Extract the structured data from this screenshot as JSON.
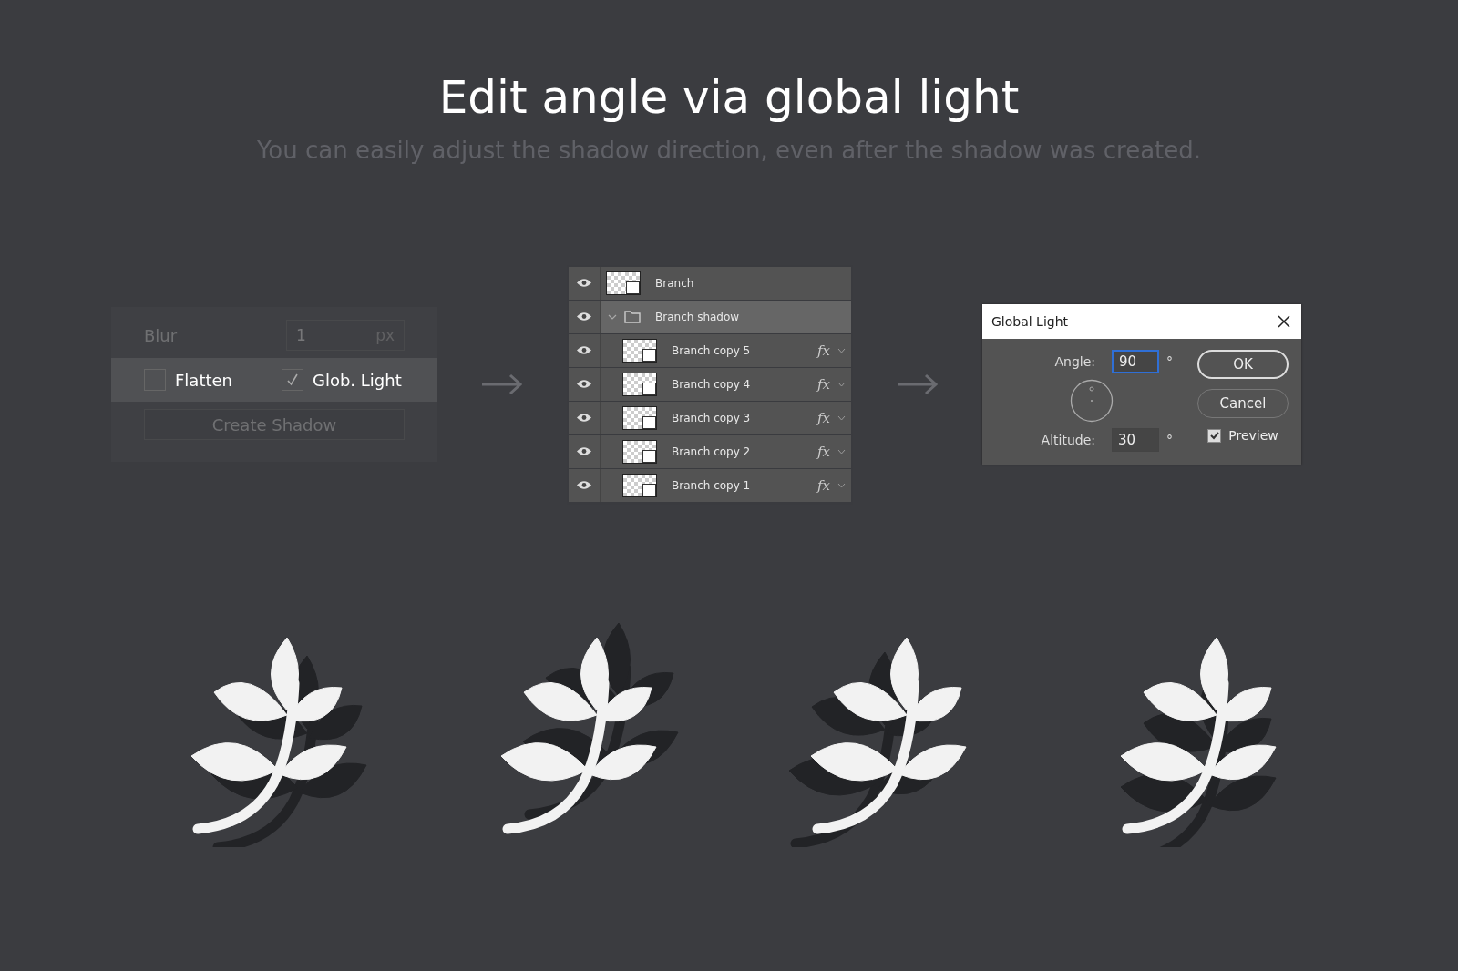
{
  "heading": {
    "title": "Edit angle via global light",
    "subtitle": "You can easily adjust the shadow direction, even after the shadow was created."
  },
  "shadow_panel": {
    "blur": {
      "label": "Blur",
      "value": "1",
      "unit": "px",
      "disabled": true
    },
    "checkboxes": [
      {
        "label": "Flatten",
        "checked": false
      },
      {
        "label": "Glob. Light",
        "checked": true
      }
    ],
    "button": {
      "label": "Create Shadow",
      "disabled": true
    }
  },
  "layers": [
    {
      "kind": "layer",
      "name": "Branch",
      "selected": false
    },
    {
      "kind": "group",
      "name": "Branch shadow",
      "selected": true,
      "expanded": true,
      "children": [
        {
          "kind": "layer",
          "name": "Branch copy 5",
          "selected": false,
          "effects": "fx"
        },
        {
          "kind": "layer",
          "name": "Branch copy 4",
          "selected": false,
          "effects": "fx"
        },
        {
          "kind": "layer",
          "name": "Branch copy 3",
          "selected": false,
          "effects": "fx"
        },
        {
          "kind": "layer",
          "name": "Branch copy 2",
          "selected": false,
          "effects": "fx"
        },
        {
          "kind": "layer",
          "name": "Branch copy 1",
          "selected": false,
          "effects": "fx"
        }
      ]
    }
  ],
  "dialog": {
    "title": "Global Light",
    "angle": {
      "label": "Angle:",
      "value": "90",
      "unit": "°",
      "focused": true
    },
    "altitude": {
      "label": "Altitude:",
      "value": "30",
      "unit": "°",
      "focused": false
    },
    "buttons": [
      {
        "label": "OK",
        "default": true
      },
      {
        "label": "Cancel",
        "default": false
      }
    ],
    "preview": {
      "label": "Preview",
      "checked": true
    }
  }
}
